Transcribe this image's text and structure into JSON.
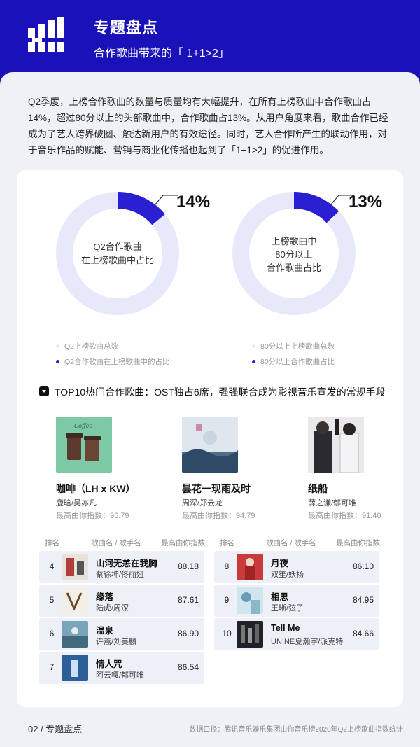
{
  "header": {
    "title": "专题盘点",
    "subtitle": "合作歌曲带来的「 1+1>2」"
  },
  "intro": "Q2季度，上榜合作歌曲的数量与质量均有大幅提升，在所有上榜歌曲中合作歌曲占14%，超过80分以上的头部歌曲中，合作歌曲占13%。从用户角度来看，歌曲合作已经成为了艺人跨界破圈、触达新用户的有效途径。同时，艺人合作所产生的联动作用，对于音乐作品的赋能、营销与商业化传播也起到了「1+1>2」的促进作用。",
  "colors": {
    "accent": "#2a1fd1",
    "ring": "#e7e9fa",
    "header_bg": "#1a12b8"
  },
  "chart_data": [
    {
      "type": "pie",
      "center_label": [
        "Q2合作歌曲",
        "在上榜歌曲中占比"
      ],
      "value_label": "14%",
      "values": [
        86,
        14
      ],
      "legend": [
        "Q2上榜歌曲总数",
        "Q2合作歌曲在上榜歌曲中的占比"
      ]
    },
    {
      "type": "pie",
      "center_label": [
        "上榜歌曲中",
        "80分以上",
        "合作歌曲占比"
      ],
      "value_label": "13%",
      "values": [
        87,
        13
      ],
      "legend": [
        "80分以上上榜歌曲总数",
        "80分以上合作歌曲占比"
      ]
    }
  ],
  "section": {
    "title": "TOP10热门合作歌曲：OST独占6席，强强联合成为影视音乐宣发的常规手段"
  },
  "top3": [
    {
      "title": "咖啡（LH x KW）",
      "artist": "鹿晗/吴亦凡",
      "score": "最高由你指数：96.79"
    },
    {
      "title": "昙花一现雨及时",
      "artist": "周深/郑云龙",
      "score": "最高由你指数：94.79"
    },
    {
      "title": "纸船",
      "artist": "薛之谦/郁可唯",
      "score": "最高由你指数：91.40"
    }
  ],
  "table": {
    "headers": [
      "排名",
      "歌曲名 / 歌手名",
      "最高由你指数"
    ],
    "left": [
      {
        "rank": "4",
        "song": "山河无恙在我胸",
        "artist": "蔡徐坤/佟丽娅",
        "score": "88.18"
      },
      {
        "rank": "5",
        "song": "缘落",
        "artist": "陆虎/周深",
        "score": "87.61"
      },
      {
        "rank": "6",
        "song": "温泉",
        "artist": "许嵩/刘美麟",
        "score": "86.90"
      },
      {
        "rank": "7",
        "song": "情人咒",
        "artist": "阿云嘎/郁可唯",
        "score": "86.54"
      }
    ],
    "right": [
      {
        "rank": "8",
        "song": "月夜",
        "artist": "双笙/妖扬",
        "score": "86.10"
      },
      {
        "rank": "9",
        "song": "相思",
        "artist": "王晰/弦子",
        "score": "84.95"
      },
      {
        "rank": "10",
        "song": "Tell Me",
        "artist": "UNINE夏瀚宇/派克特",
        "score": "84.66"
      }
    ]
  },
  "footer": {
    "page": "02 / 专题盘点",
    "source": "数据口径：腾讯音乐娱乐集团由你音乐榜2020年Q2上榜歌曲指数统计"
  }
}
